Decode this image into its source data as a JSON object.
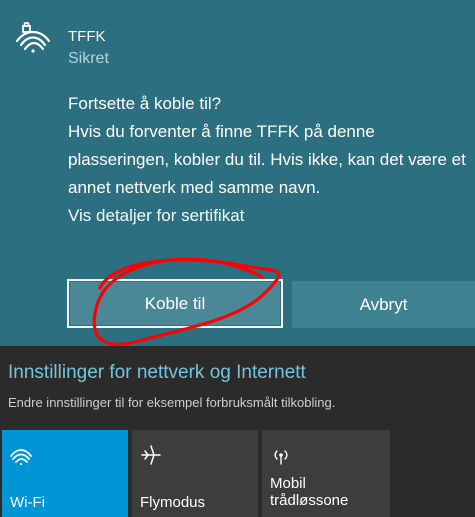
{
  "network": {
    "name": "TFFK",
    "status": "Sikret"
  },
  "prompt": {
    "question": "Fortsette å koble til?",
    "message": "Hvis du forventer å finne TFFK på denne plasseringen, kobler du til. Hvis ikke, kan det være et annet nettverk med samme navn.",
    "certificate_link": "Vis detaljer for sertifikat"
  },
  "buttons": {
    "connect": "Koble til",
    "cancel": "Avbryt"
  },
  "settings": {
    "title": "Innstillinger for nettverk og Internett",
    "description": "Endre innstillinger til for eksempel forbruksmålt tilkobling."
  },
  "quick_actions": [
    {
      "label": "Wi-Fi",
      "icon": "wifi-icon",
      "active": true
    },
    {
      "label": "Flymodus",
      "icon": "airplane-icon",
      "active": false
    },
    {
      "label": "Mobil\ntrådløssone",
      "icon": "mobile-hotspot-icon",
      "active": false
    }
  ],
  "annotation": {
    "shape": "red-circle",
    "color": "#ff0000"
  },
  "colors": {
    "panel": "#2b6f80",
    "accent": "#0096d6",
    "settings_link": "#77c3dc",
    "dark_background": "#2b2b2b"
  }
}
